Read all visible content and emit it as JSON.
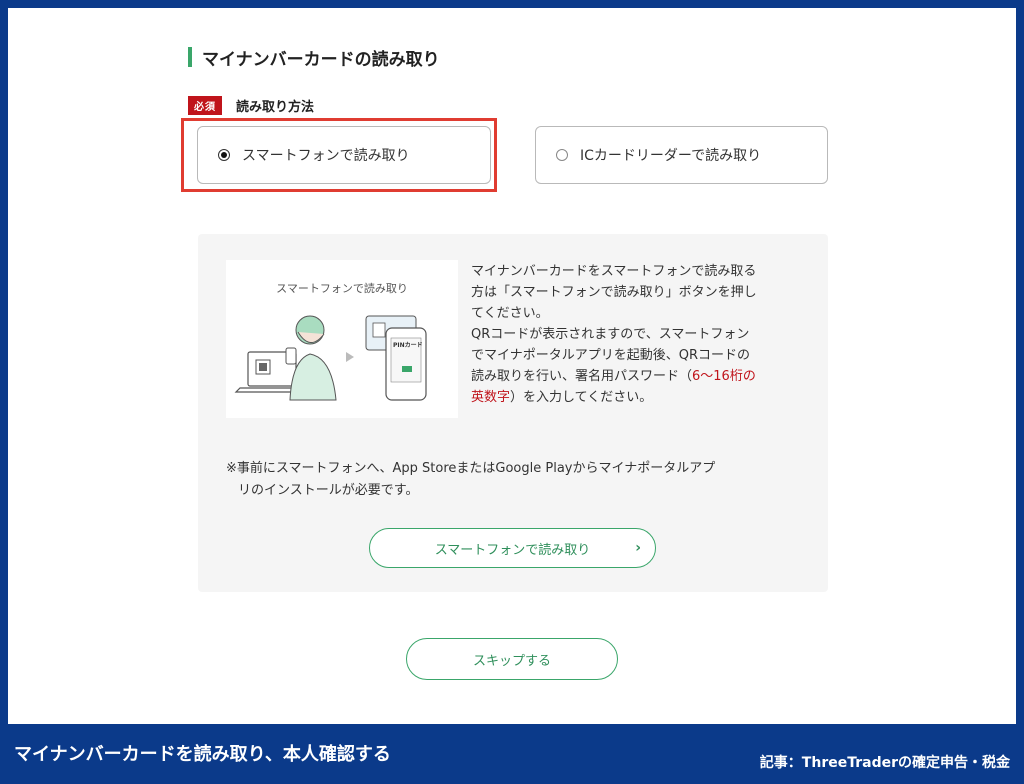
{
  "section": {
    "title": "マイナンバーカードの読み取り"
  },
  "method": {
    "required_badge": "必須",
    "label": "読み取り方法",
    "options": [
      {
        "label": "スマートフォンで読み取り",
        "selected": true
      },
      {
        "label": "ICカードリーダーで読み取り",
        "selected": false
      }
    ]
  },
  "info": {
    "illustration_caption": "スマートフォンで読み取り",
    "illustration_card_label": "PINカード",
    "text_lines": [
      "マイナンバーカードをスマートフォンで読み取る",
      "方は「スマートフォンで読み取り」ボタンを押し",
      "てください。",
      "QRコードが表示されますので、スマートフォン",
      "でマイナポータルアプリを起動後、QRコードの",
      "読み取りを行い、署名用パスワード（"
    ],
    "highlight_part1": "6〜16桁の",
    "highlight_part2": "英数字",
    "text_tail": "）を入力してください。",
    "note_line1": "※事前にスマートフォンへ、App StoreまたはGoogle Playからマイナポータルアプ",
    "note_line2": "リのインストールが必要です。",
    "smartphone_button": "スマートフォンで読み取り",
    "chevron_icon": "chevron-right-icon"
  },
  "skip_button": "スキップする",
  "footer": {
    "title": "マイナンバーカードを読み取り、本人確認する",
    "credit": "記事：ThreeTraderの確定申告・税金"
  },
  "colors": {
    "accent": "#3aa66a",
    "badge": "#c0141b",
    "highlight": "#e03c31",
    "frame": "#0b3a8a"
  }
}
